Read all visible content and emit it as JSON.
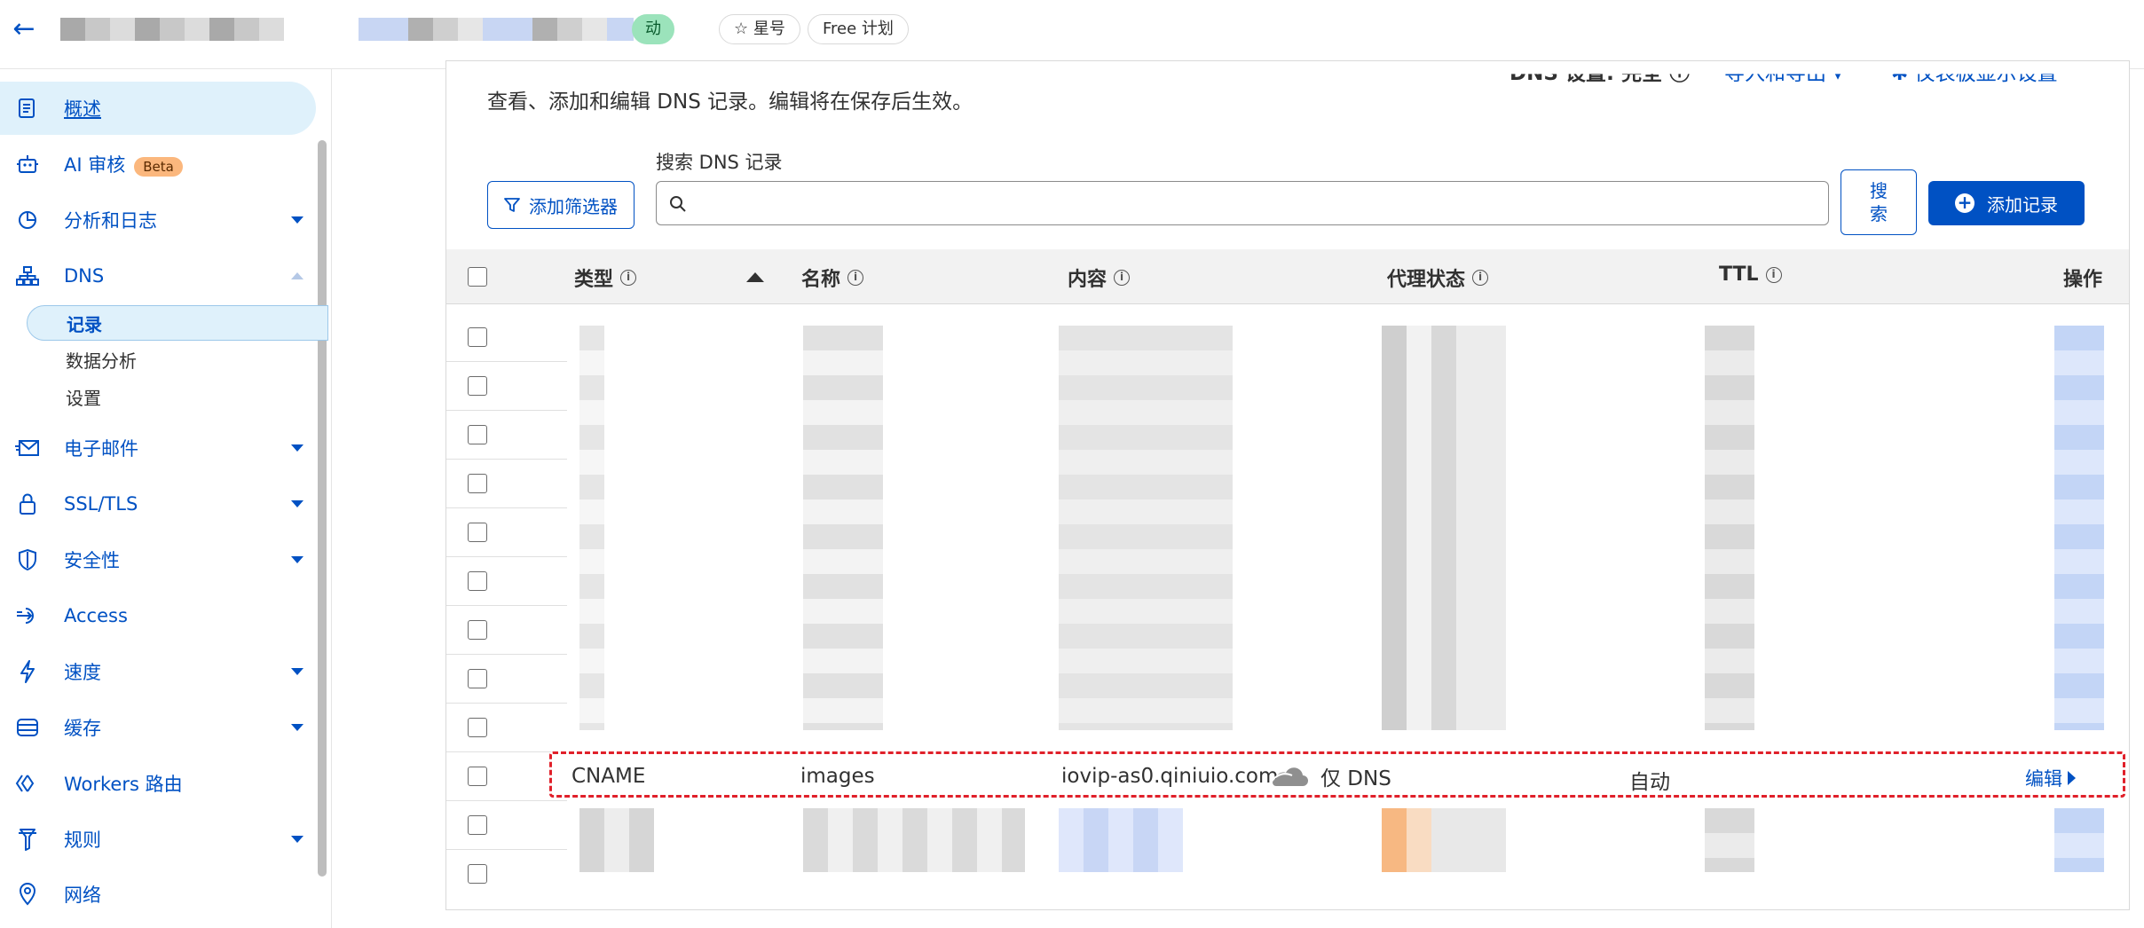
{
  "topbar": {
    "status_pill": "动",
    "star_label": "☆ 星号",
    "plan_label": "Free 计划"
  },
  "sidebar": {
    "items": [
      {
        "label": "概述",
        "icon": "document-icon"
      },
      {
        "label": "AI 审核",
        "icon": "robot-icon",
        "badge": "Beta"
      },
      {
        "label": "分析和日志",
        "icon": "pie-chart-icon"
      },
      {
        "label": "DNS",
        "icon": "network-icon"
      },
      {
        "label": "电子邮件",
        "icon": "envelope-icon"
      },
      {
        "label": "SSL/TLS",
        "icon": "lock-icon"
      },
      {
        "label": "安全性",
        "icon": "shield-icon"
      },
      {
        "label": "Access",
        "icon": "access-icon"
      },
      {
        "label": "速度",
        "icon": "lightning-icon"
      },
      {
        "label": "缓存",
        "icon": "database-icon"
      },
      {
        "label": "Workers 路由",
        "icon": "workers-icon"
      },
      {
        "label": "规则",
        "icon": "rules-icon"
      },
      {
        "label": "网络",
        "icon": "location-pin-icon"
      }
    ],
    "dns_sub": [
      {
        "label": "记录"
      },
      {
        "label": "数据分析"
      },
      {
        "label": "设置"
      }
    ]
  },
  "main": {
    "description": "查看、添加和编辑 DNS 记录。编辑将在保存后生效。",
    "header_right": {
      "dns_setting": "DNS 设置: 完全 ⓘ",
      "import_export": "导入和导出 ▾",
      "dashboard_display": "✱ 仪表板显示设置"
    },
    "search_label": "搜索 DNS 记录",
    "search_placeholder": "",
    "filter_button": "添加筛选器",
    "search_button": "搜\n索",
    "search_button_line1": "搜",
    "search_button_line2": "索",
    "add_button": "添加记录",
    "table": {
      "headers": {
        "type": "类型",
        "name": "名称",
        "content": "内容",
        "proxy": "代理状态",
        "ttl": "TTL",
        "action": "操作"
      },
      "highlight_row": {
        "type": "CNAME",
        "name": "images",
        "content": "iovip-as0.qiniuio.com",
        "proxy": "仅 DNS",
        "ttl": "自动",
        "action": "编辑"
      }
    }
  }
}
